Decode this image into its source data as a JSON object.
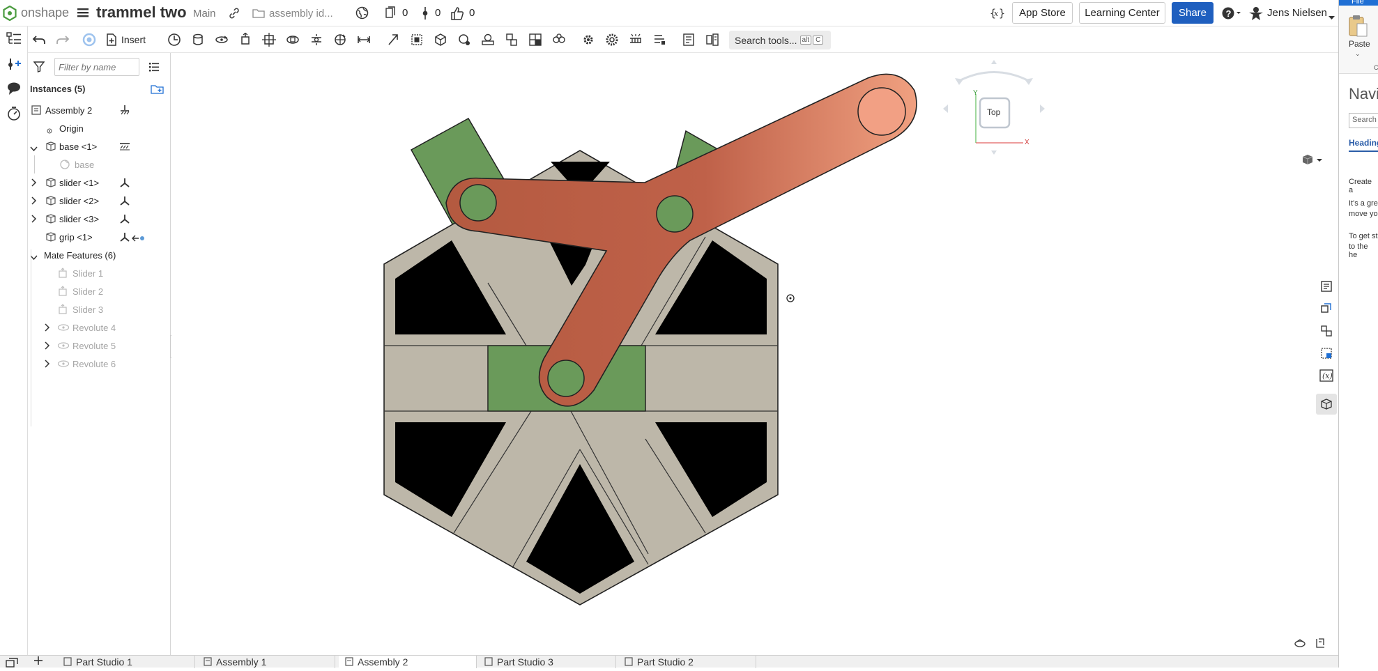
{
  "app": {
    "brand": "onshape",
    "doc_title": "trammel two",
    "branch": "Main",
    "doc_path": "assembly id..."
  },
  "counters": {
    "copies": "0",
    "versions": "0",
    "likes": "0"
  },
  "header": {
    "app_store": "App Store",
    "learning_center": "Learning Center",
    "share": "Share",
    "user": "Jens Nielsen"
  },
  "toolbar": {
    "insert": "Insert",
    "search_label": "Search tools...",
    "shortcut_alt": "alt",
    "shortcut_key": "C"
  },
  "feature_panel": {
    "filter_placeholder": "Filter by name",
    "instances_header": "Instances (5)",
    "instances": [
      {
        "label": "Assembly 2"
      },
      {
        "label": "Origin"
      },
      {
        "label": "base <1>"
      },
      {
        "label": "base"
      },
      {
        "label": "slider <1>"
      },
      {
        "label": "slider <2>"
      },
      {
        "label": "slider <3>"
      },
      {
        "label": "grip <1>"
      }
    ],
    "mates_header": "Mate Features (6)",
    "mates": [
      {
        "label": "Slider 1"
      },
      {
        "label": "Slider 2"
      },
      {
        "label": "Slider 3"
      },
      {
        "label": "Revolute 4"
      },
      {
        "label": "Revolute 5"
      },
      {
        "label": "Revolute 6"
      }
    ]
  },
  "view_cube": {
    "face": "Top",
    "axis_x": "X",
    "axis_y": "Y"
  },
  "tabs": [
    {
      "label": "Part Studio 1",
      "active": false
    },
    {
      "label": "Assembly 1",
      "active": false
    },
    {
      "label": "Assembly 2",
      "active": true
    },
    {
      "label": "Part Studio 3",
      "active": false
    },
    {
      "label": "Part Studio 2",
      "active": false
    }
  ],
  "side_panel": {
    "file_tab": "File",
    "paste": "Paste",
    "navi": "Navi",
    "search": "Search",
    "heading": "Heading",
    "line1": "Create a",
    "line2a": "It's a gre",
    "line2b": "move yo",
    "line3a": "To get st",
    "line3b": "to the he",
    "clip_c": "C"
  },
  "colors": {
    "accent": "#1f6fd4",
    "share_bg": "#1f5fbf",
    "green_part": "#6a9a5a",
    "grip": "#c1614a",
    "base_gray": "#bdb7a9"
  }
}
